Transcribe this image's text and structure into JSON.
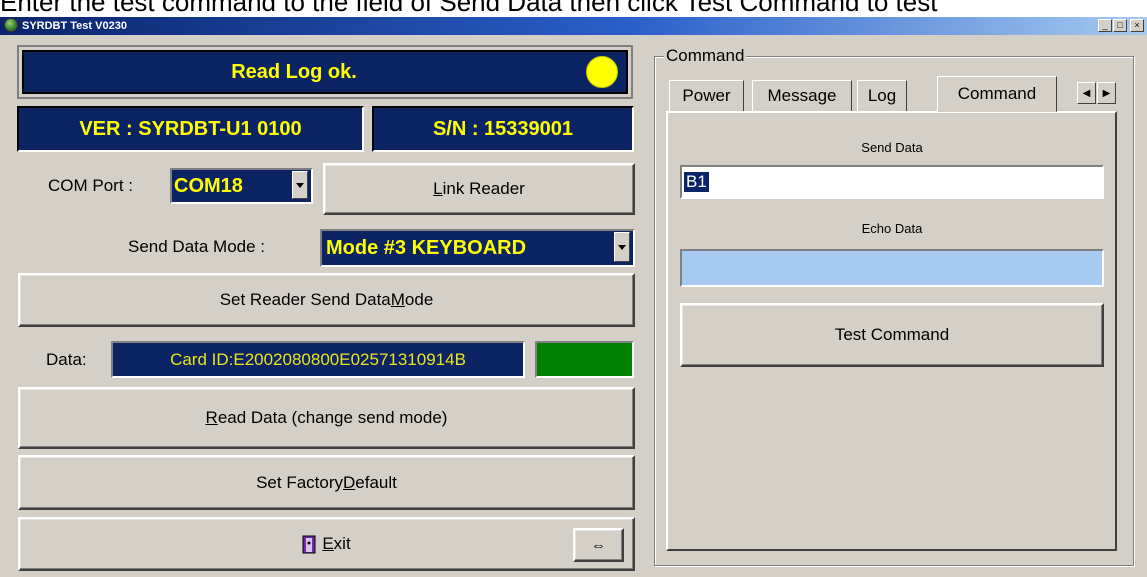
{
  "instruction": "Enter the test command to the field of Send Data then click Test Command to test",
  "window": {
    "title": "SYRDBT Test  V0230",
    "buttons": {
      "minimize": "_",
      "maximize": "□",
      "close": "×"
    }
  },
  "status": {
    "message": "Read Log ok.",
    "led_color": "#ffff00"
  },
  "info": {
    "version": "VER : SYRDBT-U1   0100",
    "serial": "S/N : 15339001"
  },
  "com_port": {
    "label": "COM Port :",
    "value": "COM18"
  },
  "link_button": {
    "text_pre": "",
    "accel": "L",
    "text_post": "ink Reader"
  },
  "send_mode": {
    "label": "Send Data Mode :",
    "value": "Mode #3 KEYBOARD"
  },
  "set_mode_button": {
    "text_pre": "Set Reader Send Data ",
    "accel": "M",
    "text_post": "ode"
  },
  "data": {
    "label": "Data:",
    "value": "Card ID:E2002080800E02571310914B",
    "indicator_color": "#008000"
  },
  "read_button": {
    "text_pre": "",
    "accel": "R",
    "text_post": "ead Data (change send mode)"
  },
  "factory_button": {
    "text_pre": "Set Factory ",
    "accel": "D",
    "text_post": "efault"
  },
  "exit_button": {
    "text_pre": "",
    "accel": "E",
    "text_post": "xit",
    "icon": "exit-door-icon"
  },
  "toggle_button": {
    "symbol": "⇔"
  },
  "command_panel": {
    "group_label": "Command",
    "tabs": [
      "Power",
      "Message",
      "Log",
      "Command"
    ],
    "active_tab": "Command",
    "send_label": "Send Data",
    "send_value": "B1",
    "echo_label": "Echo Data",
    "echo_value": "",
    "test_button": "Test Command"
  }
}
